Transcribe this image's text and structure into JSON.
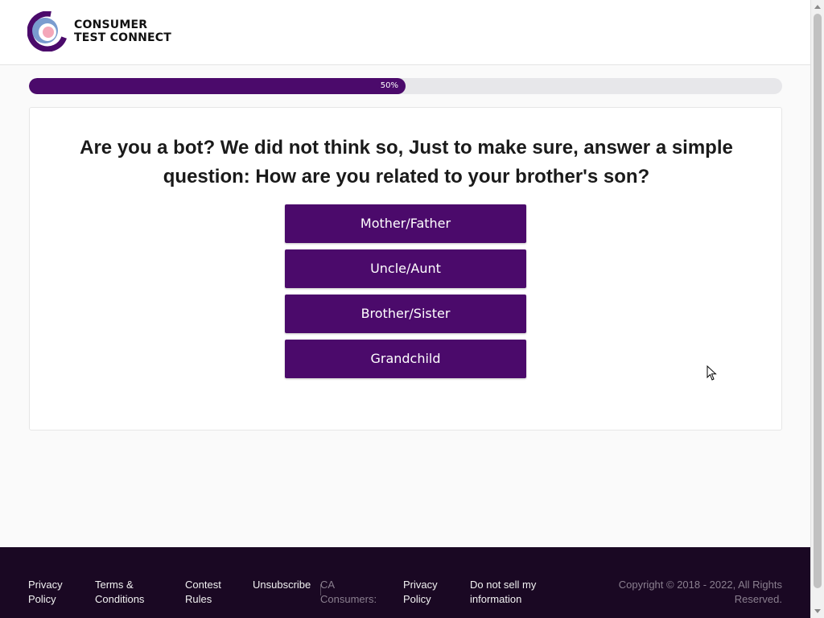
{
  "brand": {
    "name_line1": "CONSUMER",
    "name_line2": "TEST CONNECT",
    "accent_color": "#4b0a6b",
    "logo_icon": "brand-logo-icon"
  },
  "progress": {
    "label": "50%",
    "value_fraction": 0.5
  },
  "question": {
    "text": "Are you a bot? We did not think so, Just to make sure, answer a simple question: How are you related to your brother's son?"
  },
  "answers": [
    {
      "label": "Mother/Father"
    },
    {
      "label": "Uncle/Aunt"
    },
    {
      "label": "Brother/Sister"
    },
    {
      "label": "Grandchild"
    }
  ],
  "footer": {
    "privacy_policy": "Privacy Policy",
    "terms": "Terms & Conditions",
    "contest_rules": "Contest Rules",
    "unsubscribe": "Unsubscribe",
    "ca_consumers": "CA Consumers:",
    "ca_privacy_policy": "Privacy Policy",
    "do_not_sell": "Do not sell my information",
    "copyright": "Copyright © 2018 - 2022, All Rights Reserved.",
    "background_color": "#1a0823"
  }
}
